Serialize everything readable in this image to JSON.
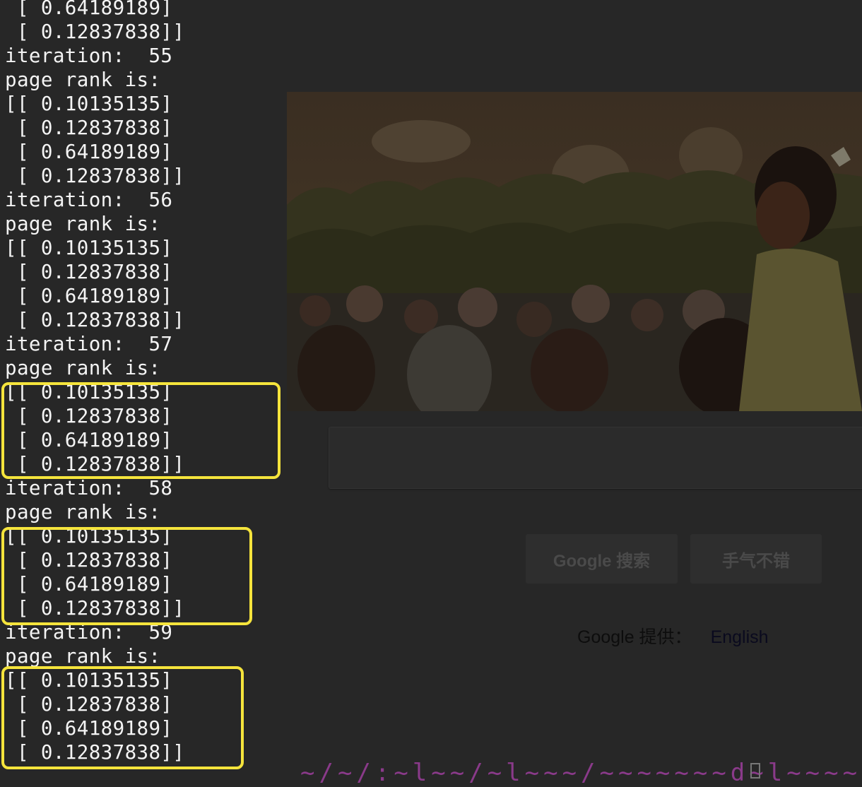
{
  "terminal": {
    "lines": [
      " [ 0.64189189]",
      " [ 0.12837838]]",
      "iteration:  55",
      "page rank is:",
      "[[ 0.10135135]",
      " [ 0.12837838]",
      " [ 0.64189189]",
      " [ 0.12837838]]",
      "iteration:  56",
      "page rank is:",
      "[[ 0.10135135]",
      " [ 0.12837838]",
      " [ 0.64189189]",
      " [ 0.12837838]]",
      "iteration:  57",
      "page rank is:",
      "[[ 0.10135135]",
      " [ 0.12837838]",
      " [ 0.64189189]",
      " [ 0.12837838]]",
      "iteration:  58",
      "page rank is:",
      "[[ 0.10135135]",
      " [ 0.12837838]",
      " [ 0.64189189]",
      " [ 0.12837838]]",
      "iteration:  59",
      "page rank is:",
      "[[ 0.10135135]",
      " [ 0.12837838]",
      " [ 0.64189189]",
      " [ 0.12837838]]"
    ]
  },
  "google": {
    "search_button": "Google 搜索",
    "lucky_button": "手气不错",
    "offered_in": "Google 提供：",
    "language_link": "English"
  },
  "colors": {
    "highlight": "#f5e43c",
    "terminal_bg": "#272727",
    "terminal_text": "#f4f4f4"
  }
}
